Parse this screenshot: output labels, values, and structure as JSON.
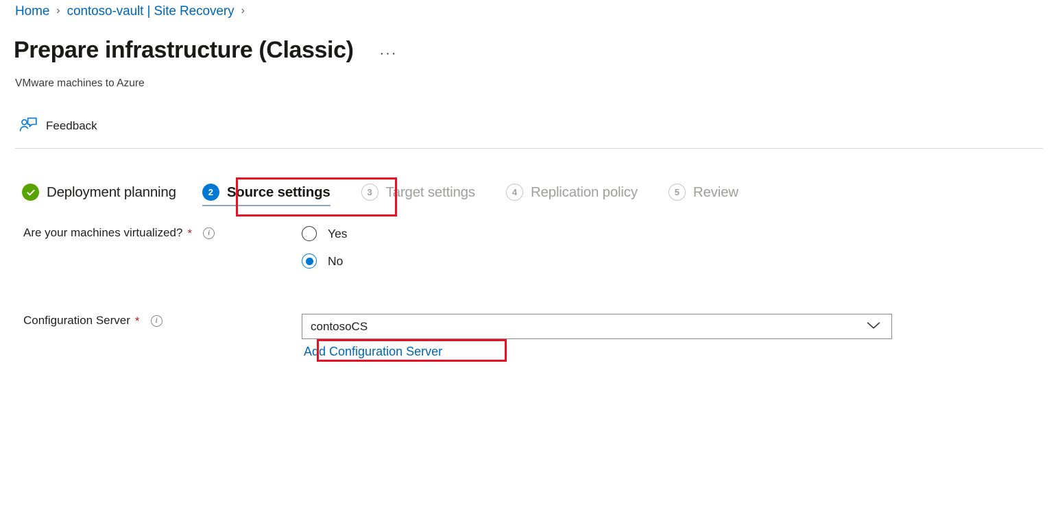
{
  "breadcrumb": {
    "name": "breadcrumb",
    "items": [
      {
        "label": "Home",
        "type": "link"
      },
      {
        "label": "contoso-vault | Site Recovery",
        "type": "link"
      }
    ],
    "separator": "›"
  },
  "header": {
    "title": "Prepare infrastructure (Classic)",
    "subtitle": "VMware machines to Azure",
    "more_menu_label": "···",
    "more_menu_name": "more-options-icon"
  },
  "commandbar": {
    "feedback": {
      "label": "Feedback",
      "icon": "feedback-person-comment-icon"
    }
  },
  "wizard": {
    "steps": [
      {
        "number": "✓",
        "label": "Deployment planning",
        "state": "done"
      },
      {
        "number": "2",
        "label": "Source settings",
        "state": "active"
      },
      {
        "number": "3",
        "label": "Target settings",
        "state": "pending"
      },
      {
        "number": "4",
        "label": "Replication policy",
        "state": "pending"
      },
      {
        "number": "5",
        "label": "Review",
        "state": "pending"
      }
    ]
  },
  "form": {
    "virtualized": {
      "label": "Are your machines virtualized?",
      "required_marker": "*",
      "info_glyph": "i",
      "options": [
        {
          "label": "Yes",
          "selected": false
        },
        {
          "label": "No",
          "selected": true
        }
      ]
    },
    "configuration_server": {
      "label": "Configuration Server",
      "required_marker": "*",
      "info_glyph": "i",
      "value": "contosoCS",
      "add_link": "Add Configuration Server"
    }
  },
  "colors": {
    "link": "#0067b8",
    "accent": "#0078d4",
    "success": "#57a300",
    "required": "#a4262c",
    "annotation": "#e81123",
    "disabled_text": "#a19f9d",
    "border": "#8a8886",
    "divider": "#d6d6d6"
  }
}
